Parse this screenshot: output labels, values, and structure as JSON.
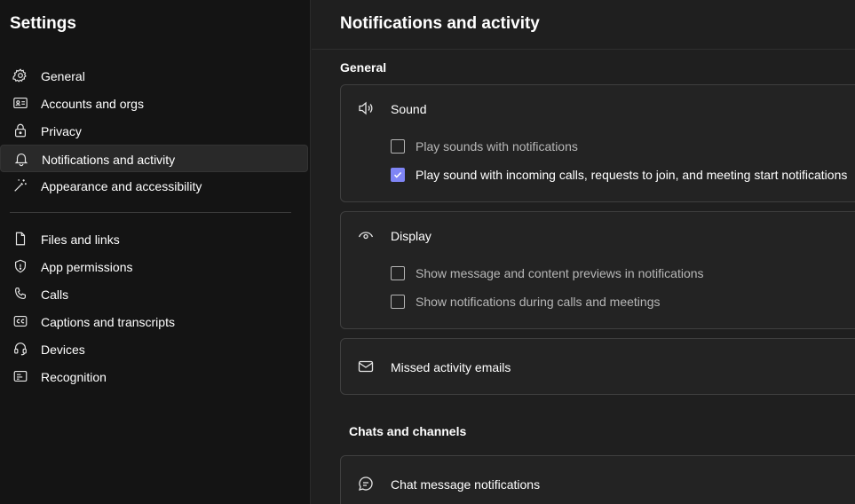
{
  "sidebar": {
    "title": "Settings",
    "items": [
      {
        "label": "General",
        "icon": "gear-icon"
      },
      {
        "label": "Accounts and orgs",
        "icon": "id-card-icon"
      },
      {
        "label": "Privacy",
        "icon": "lock-icon"
      },
      {
        "label": "Notifications and activity",
        "icon": "bell-icon",
        "active": true
      },
      {
        "label": "Appearance and accessibility",
        "icon": "magic-wand-icon"
      },
      {
        "label": "Files and links",
        "icon": "document-icon"
      },
      {
        "label": "App permissions",
        "icon": "shield-icon"
      },
      {
        "label": "Calls",
        "icon": "phone-icon"
      },
      {
        "label": "Captions and transcripts",
        "icon": "closed-captions-icon"
      },
      {
        "label": "Devices",
        "icon": "headset-icon"
      },
      {
        "label": "Recognition",
        "icon": "recognition-icon"
      }
    ]
  },
  "main": {
    "title": "Notifications and activity",
    "general_section": "General",
    "sound": {
      "label": "Sound",
      "icon": "speaker-icon",
      "options": [
        {
          "label": "Play sounds with notifications",
          "checked": false
        },
        {
          "label": "Play sound with incoming calls, requests to join, and meeting start notifications",
          "checked": true
        }
      ]
    },
    "display": {
      "label": "Display",
      "icon": "eye-icon",
      "options": [
        {
          "label": "Show message and content previews in notifications",
          "checked": false
        },
        {
          "label": "Show notifications during calls and meetings",
          "checked": false
        }
      ]
    },
    "missed_activity": {
      "label": "Missed activity emails",
      "icon": "mail-icon"
    },
    "chats_section": "Chats and channels",
    "chat_message": {
      "label": "Chat message notifications",
      "icon": "chat-bubble-icon"
    }
  },
  "colors": {
    "accent": "#7f85f5",
    "sidebar_bg": "#141414",
    "main_bg": "#1f1f1f"
  }
}
